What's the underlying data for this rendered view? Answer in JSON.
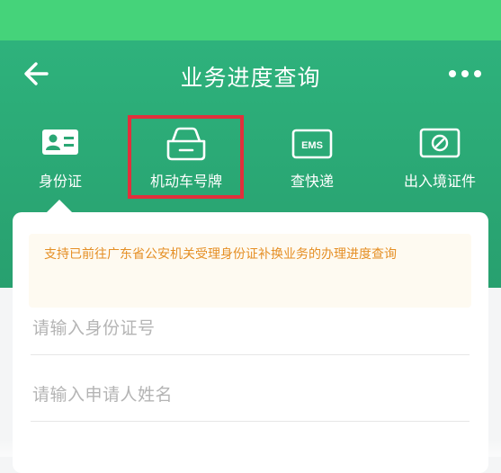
{
  "navbar": {
    "title": "业务进度查询",
    "back_icon": "arrow-left-icon",
    "more_icon": "more-dots-icon"
  },
  "tabs": [
    {
      "label": "身份证",
      "icon": "id-card-icon"
    },
    {
      "label": "机动车号牌",
      "icon": "car-icon"
    },
    {
      "label": "查快递",
      "icon": "ems-icon"
    },
    {
      "label": "出入境证件",
      "icon": "passport-icon"
    }
  ],
  "tab_icon_text": {
    "ems": "EMS"
  },
  "notice": {
    "text": "支持已前往广东省公安机关受理身份证补换业务的办理进度查询"
  },
  "form": {
    "id_placeholder": "请输入身份证号",
    "name_placeholder": "请输入申请人姓名"
  },
  "colors": {
    "status_bar": "#45d37a",
    "header": "#2aa774",
    "highlight": "#e1303c",
    "notice_text": "#e58f25"
  }
}
